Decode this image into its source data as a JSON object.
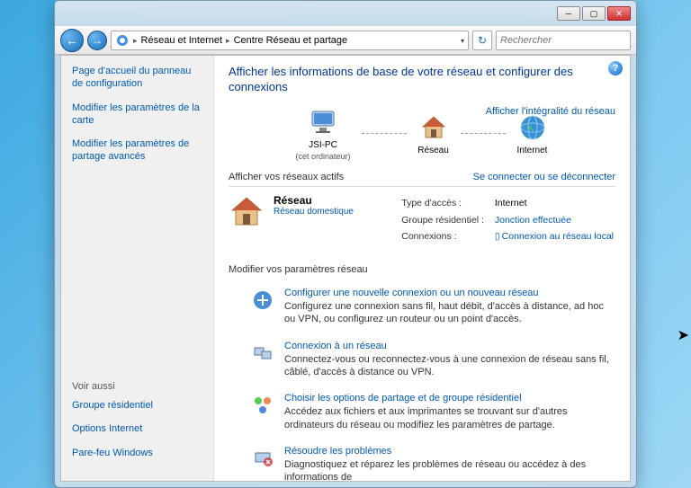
{
  "titlebar": {
    "minimize": "─",
    "maximize": "▢",
    "close": "✕"
  },
  "toolbar": {
    "back": "←",
    "forward": "→",
    "breadcrumb": {
      "item1": "Réseau et Internet",
      "item2": "Centre Réseau et partage"
    },
    "refresh": "↻",
    "search_placeholder": "Rechercher"
  },
  "sidebar": {
    "home": "Page d'accueil du panneau de configuration",
    "link1": "Modifier les paramètres de la carte",
    "link2": "Modifier les paramètres de partage avancés",
    "see_also": "Voir aussi",
    "sa1": "Groupe résidentiel",
    "sa2": "Options Internet",
    "sa3": "Pare-feu Windows"
  },
  "main": {
    "title": "Afficher les informations de base de votre réseau et configurer des connexions",
    "full_map": "Afficher l'intégralité du réseau",
    "node1": "JSI-PC",
    "node1_sub": "(cet ordinateur)",
    "node2": "Réseau",
    "node3": "Internet",
    "active_section": "Afficher vos réseaux actifs",
    "connect_link": "Se connecter ou se déconnecter",
    "net_name": "Réseau",
    "net_type": "Réseau domestique",
    "type_label": "Type d'accès :",
    "type_val": "Internet",
    "group_label": "Groupe résidentiel :",
    "group_val": "Jonction effectuée",
    "conn_label": "Connexions :",
    "conn_val": "Connexion au réseau local",
    "settings_section": "Modifier vos paramètres réseau",
    "s1_title": "Configurer une nouvelle connexion ou un nouveau réseau",
    "s1_desc": "Configurez une connexion sans fil, haut débit, d'accès à distance, ad hoc ou VPN, ou configurez un routeur ou un point d'accès.",
    "s2_title": "Connexion à un réseau",
    "s2_desc": "Connectez-vous ou reconnectez-vous à une connexion de réseau sans fil, câblé, d'accès à distance ou VPN.",
    "s3_title": "Choisir les options de partage et de groupe résidentiel",
    "s3_desc": "Accédez aux fichiers et aux imprimantes se trouvant sur d'autres ordinateurs du réseau ou modifiez les paramètres de partage.",
    "s4_title": "Résoudre les problèmes",
    "s4_desc": "Diagnostiquez et réparez les problèmes de réseau ou accédez à des informations de"
  }
}
